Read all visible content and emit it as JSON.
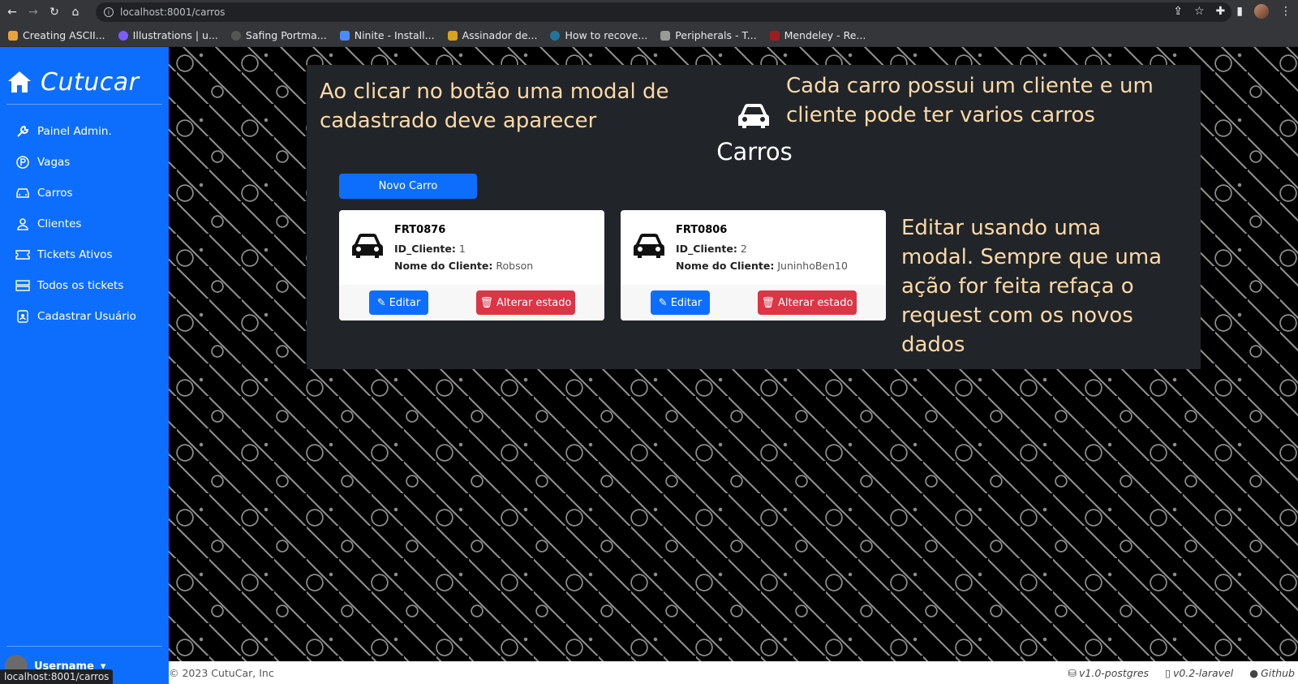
{
  "browser": {
    "url": "localhost:8001/carros",
    "bookmarks": [
      {
        "label": "Creating ASCII...",
        "color": "#e8a33d"
      },
      {
        "label": "Illustrations | u...",
        "color": "#7b5cff"
      },
      {
        "label": "Safing Portma...",
        "color": "#555"
      },
      {
        "label": "Ninite - Install...",
        "color": "#4b8bf5"
      },
      {
        "label": "Assinador de...",
        "color": "#d9a21f"
      },
      {
        "label": "How to recove...",
        "color": "#21759b"
      },
      {
        "label": "Peripherals - T...",
        "color": "#999"
      },
      {
        "label": "Mendeley - Re...",
        "color": "#9c1d1d"
      }
    ],
    "status_url": "localhost:8001/carros"
  },
  "sidebar": {
    "brand": "Cutucar",
    "items": [
      {
        "label": "Painel Admin.",
        "icon": "wrench-icon"
      },
      {
        "label": "Vagas",
        "icon": "parking-icon"
      },
      {
        "label": "Carros",
        "icon": "car-icon"
      },
      {
        "label": "Clientes",
        "icon": "person-icon"
      },
      {
        "label": "Tickets Ativos",
        "icon": "ticket-icon"
      },
      {
        "label": "Todos os tickets",
        "icon": "tickets-icon"
      },
      {
        "label": "Cadastrar Usuário",
        "icon": "person-badge-icon"
      }
    ],
    "user": "Username"
  },
  "notes": {
    "modal_note": "Ao clicar no botão uma modal de cadastrado deve aparecer",
    "relation_note": "Cada carro possui um cliente e um cliente pode ter varios carros",
    "edit_note": "Editar usando uma modal. Sempre que uma ação for feita refaça o request com os novos dados"
  },
  "page": {
    "title": "Carros",
    "new_button": "Novo Carro"
  },
  "cars": [
    {
      "plate": "FRT0876",
      "id_label": "ID_Cliente:",
      "id_value": "1",
      "name_label": "Nome do Cliente:",
      "name_value": "Robson",
      "edit_label": "Editar",
      "state_label": "Alterar estado"
    },
    {
      "plate": "FRT0806",
      "id_label": "ID_Cliente:",
      "id_value": "2",
      "name_label": "Nome do Cliente:",
      "name_value": "JuninhoBen10",
      "edit_label": "Editar",
      "state_label": "Alterar estado"
    }
  ],
  "footer": {
    "copyright": "© 2023 CutuCar, Inc",
    "db_version": "v1.0-postgres",
    "fw_version": "v0.2-laravel",
    "github": "Github"
  },
  "colors": {
    "primary": "#0d6efd",
    "danger": "#dc3545",
    "panel": "#212529",
    "note_text": "#fcd9a8"
  }
}
